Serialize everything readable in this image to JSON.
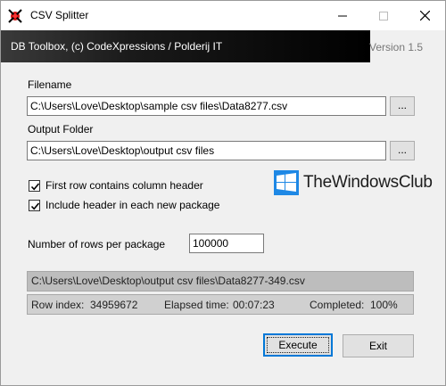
{
  "window": {
    "title": "CSV Splitter",
    "banner": "DB Toolbox, (c) CodeXpressions / Polderij IT",
    "version": "Version 1.5"
  },
  "form": {
    "filename_label": "Filename",
    "filename_value": "C:\\Users\\Love\\Desktop\\sample csv files\\Data8277.csv",
    "output_label": "Output Folder",
    "output_value": "C:\\Users\\Love\\Desktop\\output csv files",
    "browse_label": "...",
    "checkbox_header": "First row contains column header",
    "checkbox_include": "Include header in each new package",
    "rows_label": "Number of rows per package",
    "rows_value": "100000"
  },
  "status": {
    "current_file": "C:\\Users\\Love\\Desktop\\output csv files\\Data8277-349.csv",
    "row_index_label": "Row index:",
    "row_index_value": "34959672",
    "elapsed_label": "Elapsed time:",
    "elapsed_value": "00:07:23",
    "completed_label": "Completed:",
    "completed_value": "100%"
  },
  "buttons": {
    "execute": "Execute",
    "exit": "Exit"
  },
  "watermark": {
    "text": "TheWindowsClub"
  },
  "colors": {
    "accent": "#0078d7",
    "watermark_blue": "#1e88e5"
  }
}
